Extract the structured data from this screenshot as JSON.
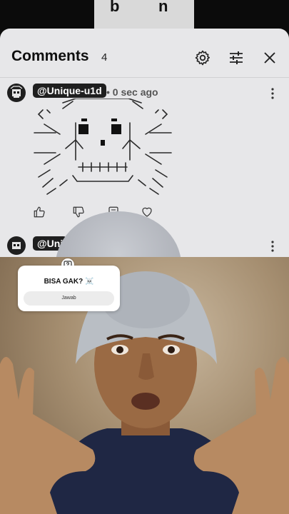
{
  "top_video": {
    "letters": [
      "b",
      "n"
    ]
  },
  "comments_panel": {
    "title": "Comments",
    "count": "4",
    "icons": {
      "settings": "gear-icon",
      "filter": "sliders-icon",
      "close": "close-icon"
    },
    "comments": [
      {
        "handle": "@Unique-u1d",
        "time": "• 0 sec ago"
      },
      {
        "handle": "@Uni"
      }
    ],
    "actions": [
      "thumb-up-icon",
      "thumb-down-icon",
      "reply-icon",
      "heart-icon"
    ]
  },
  "question_card": {
    "question": "BISA GAK? ☠️",
    "button_label": "Jawab",
    "badge_icon": "question-bubble-icon"
  },
  "colors": {
    "sheet_bg": "#e7e7e9",
    "handle_bg": "#1f1f1f",
    "card_bg": "#ffffff"
  }
}
